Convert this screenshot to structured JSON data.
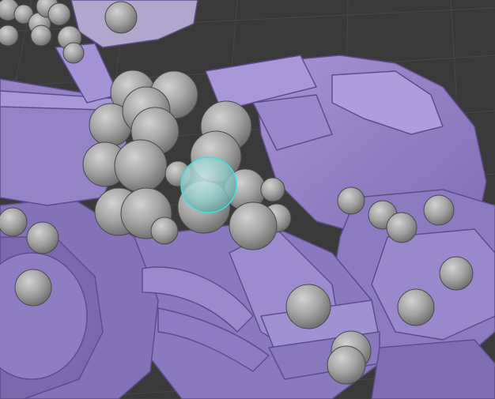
{
  "viewport": {
    "background_color": "#3a3a3a",
    "grid_color": "#464646",
    "mesh_color": "#9a87c6",
    "mesh_shadow_color": "#6d5c9a",
    "sphere_color": "#a8a8a8",
    "selected_sphere_color": "#8fd2d2",
    "selected_sphere_outline": "#3ee0e0"
  }
}
